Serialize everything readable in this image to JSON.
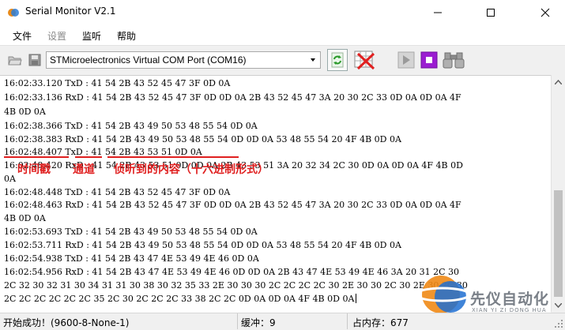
{
  "window": {
    "title": "Serial Monitor V2.1"
  },
  "menu": [
    {
      "label": "文件",
      "enabled": true
    },
    {
      "label": "设置",
      "enabled": false
    },
    {
      "label": "监听",
      "enabled": true
    },
    {
      "label": "帮助",
      "enabled": true
    }
  ],
  "toolbar": {
    "port": "STMicroelectronics Virtual COM Port (COM16)",
    "icons": [
      "folder-icon",
      "save-icon",
      "refresh-icon",
      "clear-icon",
      "play-icon",
      "stop-icon",
      "binoculars-icon"
    ]
  },
  "log": [
    "16:02:33.120 TxD : 41 54 2B 43 52 45 47 3F 0D 0A",
    "16:02:33.136 RxD : 41 54 2B 43 52 45 47 3F 0D 0D 0A 2B 43 52 45 47 3A 20 30 2C 33 0D 0A 0D 0A 4F",
    "4B 0D 0A",
    "16:02:38.366 TxD : 41 54 2B 43 49 50 53 48 55 54 0D 0A",
    "16:02:38.383 RxD : 41 54 2B 43 49 50 53 48 55 54 0D 0D 0A 53 48 55 54 20 4F 4B 0D 0A",
    "16:02:48.407 TxD : 41 54 2B 43 53 51 0D 0A",
    "16:02:48.420 RxD : 41 54 2B 43 53 51 0D 0D 0A 2B 43 53 51 3A 20 32 34 2C 30 0D 0A 0D 0A 4F 4B 0D",
    "0A",
    "16:02:48.448 TxD : 41 54 2B 43 52 45 47 3F 0D 0A",
    "16:02:48.463 RxD : 41 54 2B 43 52 45 47 3F 0D 0D 0A 2B 43 52 45 47 3A 20 30 2C 33 0D 0A 0D 0A 4F",
    "4B 0D 0A",
    "16:02:53.693 TxD : 41 54 2B 43 49 50 53 48 55 54 0D 0A",
    "16:02:53.711 RxD : 41 54 2B 43 49 50 53 48 55 54 0D 0D 0A 53 48 55 54 20 4F 4B 0D 0A",
    "16:02:54.938 TxD : 41 54 2B 43 47 4E 53 49 4E 46 0D 0A",
    "16:02:54.956 RxD : 41 54 2B 43 47 4E 53 49 4E 46 0D 0D 0A 2B 43 47 4E 53 49 4E 46 3A 20 31 2C 30",
    "2C 32 30 32 31 30 34 31 31 30 38 30 32 35 33 2E 30 30 30 2C 2C 2C 2C 30 2E 30 30 2C 30 2E 30 2C 30",
    "2C 2C 2C 2C 2C 2C 35 2C 30 2C 2C 2C 33 38 2C 2C 0D 0A 0D 0A 4F 4B 0D 0A"
  ],
  "annotation": {
    "timestamp": "时间戳",
    "channel": "通道",
    "content": "侦听到的内容（十六进制形式）"
  },
  "status": {
    "connection": "开始成功！(9600-8-None-1)",
    "buffer": "缓冲：9",
    "memory": "占内存：677"
  },
  "watermark": {
    "text": "先仪自动化",
    "sub": "XIAN YI ZI DONG HUA"
  },
  "colors": {
    "annotation": "#e02020",
    "stop_button": "#9b1dd1",
    "log_bg": "#ffffff"
  }
}
